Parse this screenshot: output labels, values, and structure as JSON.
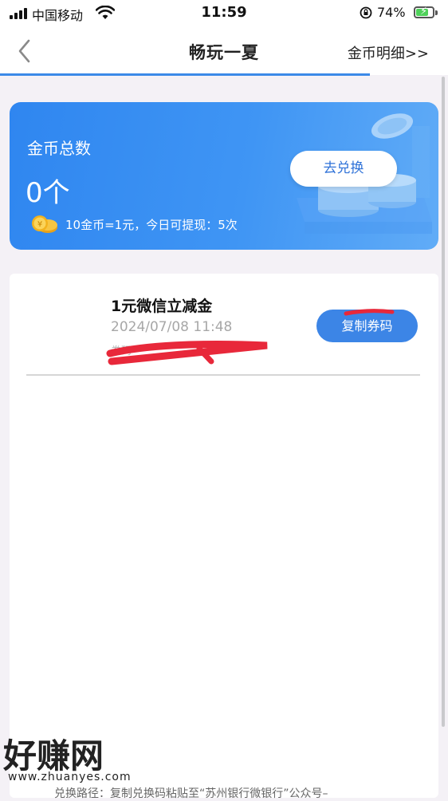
{
  "status_bar": {
    "carrier": "中国移动",
    "time": "11:59",
    "battery": "74%",
    "battery_level": 0.74
  },
  "nav": {
    "title": "畅玩一夏",
    "right_link": "金币明细>>"
  },
  "coin_card": {
    "title": "金币总数",
    "count": "0个",
    "note": "10金币=1元，今日可提现：5次",
    "exchange_button": "去兑换",
    "colors": {
      "start": "#2f86f0",
      "end": "#61acf7"
    }
  },
  "list": {
    "items": [
      {
        "name": "1元微信立减金",
        "date": "2024/07/08 11:48",
        "code_label": "券码",
        "copy_button": "复制券码"
      }
    ]
  },
  "bottom_tip": "兑换路径：复制兑换码粘贴至“苏州银行微银行”公众号–",
  "watermark": {
    "brand": "好赚网",
    "url": "www.zhuanyes.com"
  },
  "colors": {
    "accent": "#3c85e6",
    "redaction": "#e8283a"
  }
}
